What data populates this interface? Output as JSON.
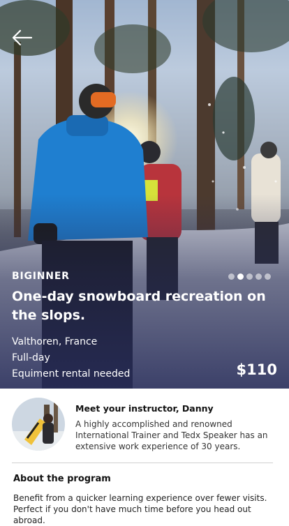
{
  "hero": {
    "level": "BIGINNER",
    "title": "One-day snowboard recreation on the slops.",
    "location": "Valthoren, France",
    "duration": "Full-day",
    "equipment": "Equiment rental needed",
    "price": "$110",
    "carousel": {
      "count": 5,
      "active_index": 1
    },
    "overlay_color": "#2b3166"
  },
  "instructor": {
    "heading": "Meet your instructor,  Danny",
    "bio": "A highly accomplished and renowned International Trainer and Tedx Speaker has an extensive work experience of 30 years."
  },
  "about": {
    "title": "About the program",
    "text": "Benefit from a quicker learning experience over fewer visits. Perfect if you don't have much time before you head out abroad."
  }
}
